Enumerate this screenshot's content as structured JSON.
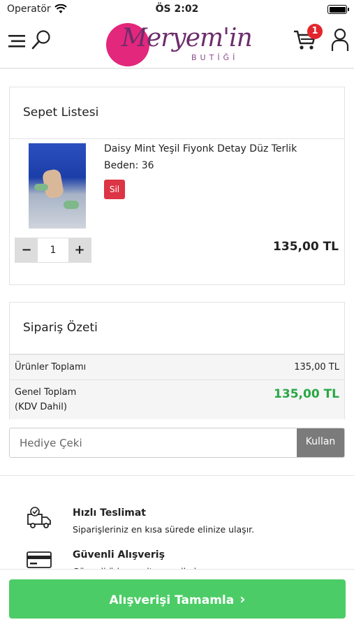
{
  "status_bar": {
    "carrier": "Operatör",
    "time": "ÖS 2:02"
  },
  "header": {
    "logo_script": "Meryem'in",
    "logo_sub": "BUTİĞİ",
    "cart_count": "1"
  },
  "cart": {
    "title": "Sepet Listesi",
    "item": {
      "name": "Daisy Mint Yeşil Fiyonk Detay Düz Terlik",
      "size": "Beden: 36",
      "delete_label": "Sil",
      "quantity": "1",
      "minus": "−",
      "plus": "+",
      "price": "135,00 TL"
    }
  },
  "summary": {
    "title": "Sipariş Özeti",
    "products_total_label": "Ürünler Toplamı",
    "products_total_value": "135,00 TL",
    "grand_total_label_1": "Genel Toplam",
    "grand_total_label_2": "(KDV Dahil)",
    "grand_total_value": "135,00 TL"
  },
  "coupon": {
    "placeholder": "Hediye Çeki",
    "apply_label": "Kullan"
  },
  "features": [
    {
      "title": "Hızlı Teslimat",
      "desc": "Siparişleriniz en kısa sürede elinize ulaşır."
    },
    {
      "title": "Güvenli Alışveriş",
      "desc": "Güvenli ödeme altyapısı ile korunur."
    }
  ],
  "checkout": {
    "label": "Alışverişi Tamamla",
    "chevron": "›"
  },
  "colors": {
    "brand": "#e2277c",
    "danger": "#dc3545",
    "success": "#28a745",
    "checkout": "#4ccc66"
  }
}
